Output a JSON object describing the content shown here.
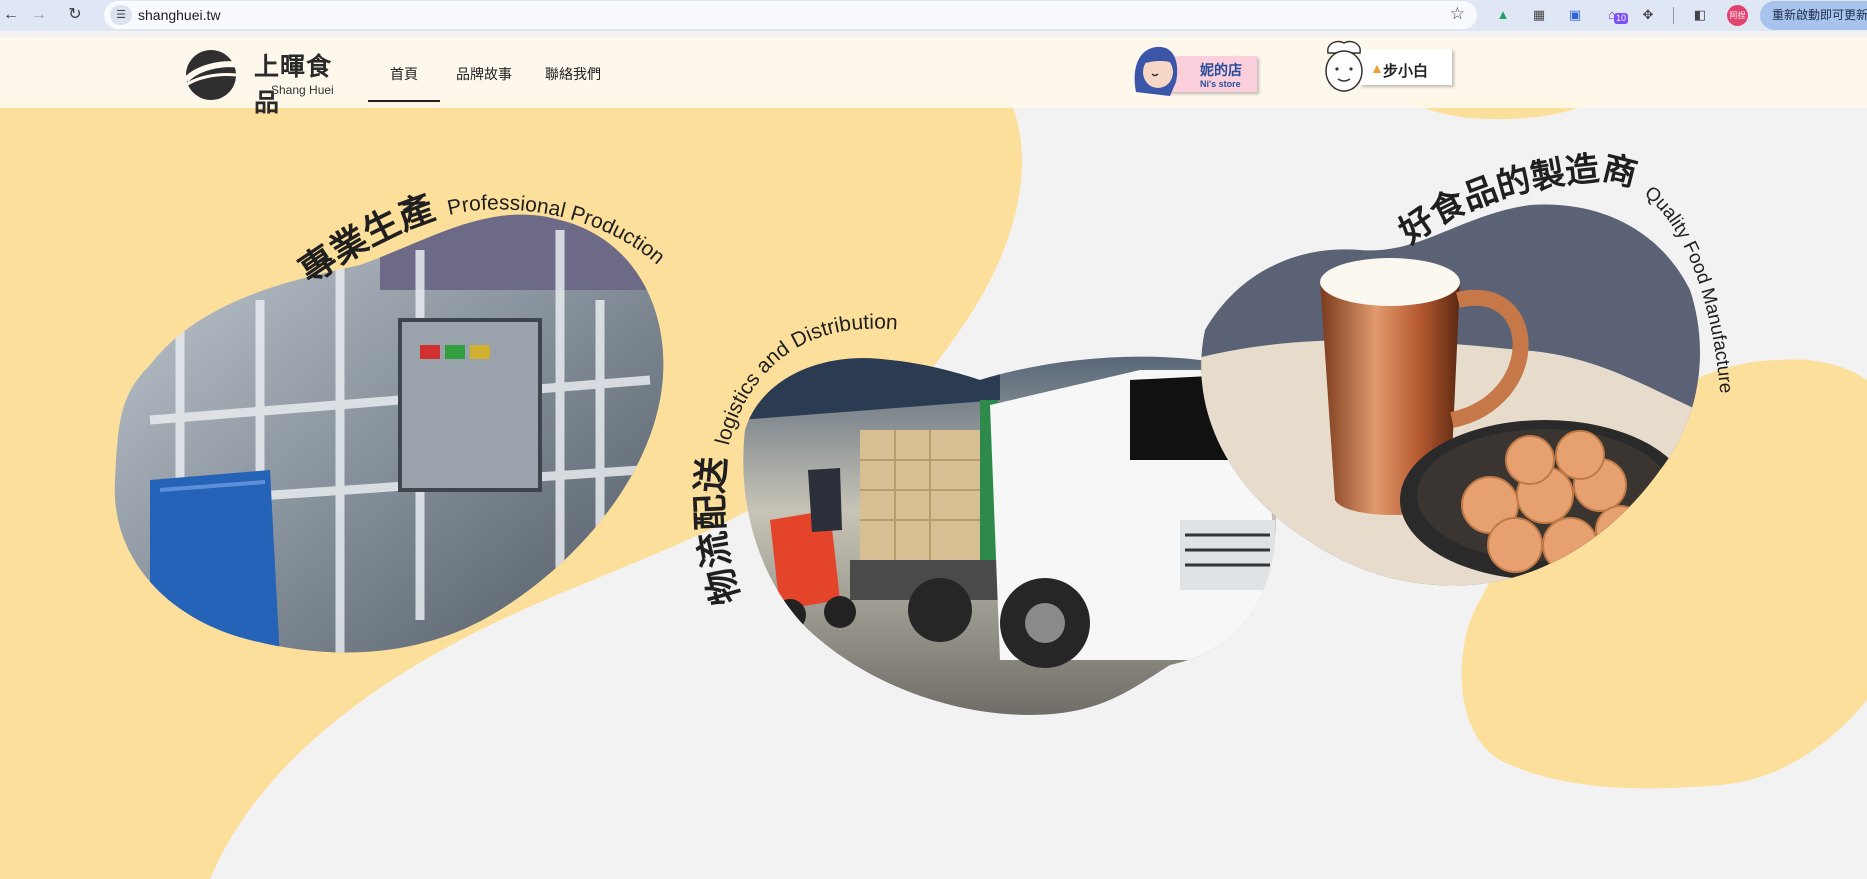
{
  "browser": {
    "url": "shanghuei.tw",
    "site_info_icon": "tune-icon",
    "profile_label": "阿捏",
    "extension_badge": "10",
    "update_label": "重新啟動即可更新"
  },
  "site": {
    "logo_name": "上暉食品",
    "logo_sub": "Shang Huei",
    "nav": [
      "首頁",
      "品牌故事",
      "聯絡我們"
    ],
    "active_nav": "首頁",
    "stores": {
      "ni_title": "妮的店",
      "ni_sub": "Ni's store",
      "bai_title": "步小白"
    }
  },
  "features": [
    {
      "zh": "專業生產",
      "en": "Professional Production",
      "image": "factory-machinery-photo"
    },
    {
      "zh": "物流配送",
      "en": "logistics and Distribution",
      "image": "delivery-truck-forklift-photo"
    },
    {
      "zh": "好食品的製造商",
      "en": "Quality Food Manufacturer",
      "image": "milk-mug-cookies-photo"
    }
  ],
  "colors": {
    "accent_yellow": "#fddf9c",
    "background": "#f2f2f2",
    "header_bg": "#fff8ec",
    "text": "#1f1f1f",
    "ni_pink": "#fbd0dc",
    "ni_blue": "#2a4d9b"
  }
}
